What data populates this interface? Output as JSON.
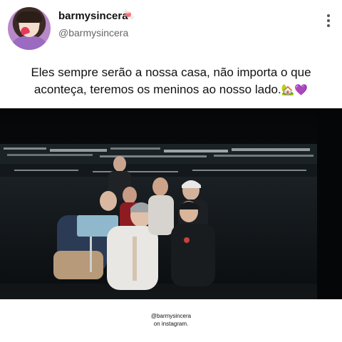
{
  "post": {
    "username": "barmysincera",
    "badge": "🍬",
    "handle": "@barmysincera",
    "text": "Eles sempre serão a nossa casa, não importa o que aconteça, teremos os meninos ao nosso lado.",
    "text_emoji": "🏡💜",
    "menu_icon": "vertical-dots-icon"
  },
  "media": {
    "type": "concert-selfie-photo",
    "colors": {
      "background": "#0a0c0e",
      "stands": "#1b2226",
      "lights": "#e8f0f2"
    }
  },
  "footer": {
    "line1": "@barmysincera",
    "line2": "on instagram."
  }
}
